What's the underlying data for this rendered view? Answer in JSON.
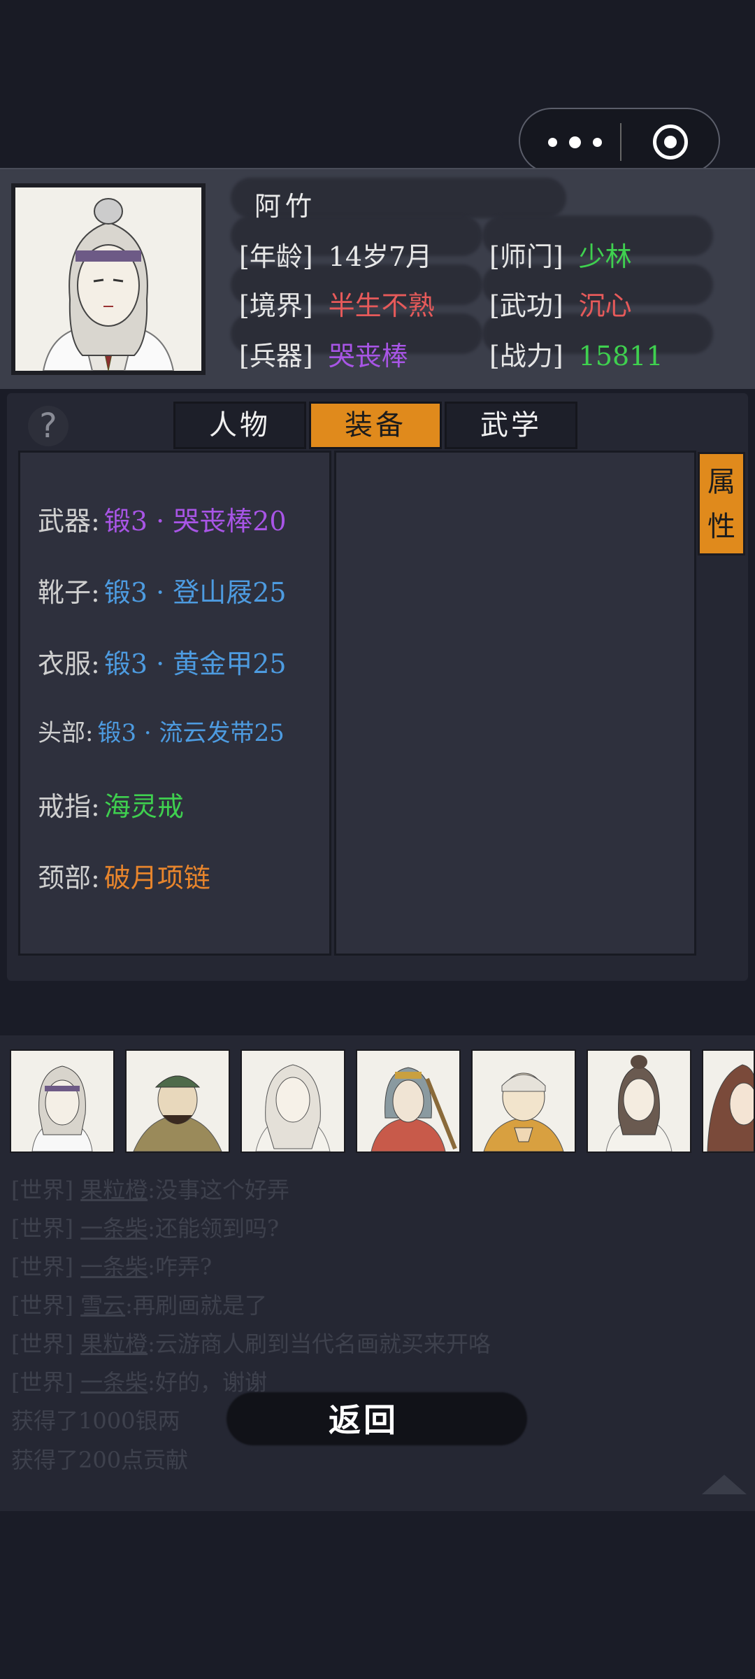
{
  "character": {
    "name": "阿竹",
    "age_label": "[年龄]",
    "age_value": "14岁7月",
    "sect_label": "[师门]",
    "sect_value": "少林",
    "realm_label": "[境界]",
    "realm_value": "半生不熟",
    "martial_label": "[武功]",
    "martial_value": "沉心",
    "weapon_label": "[兵器]",
    "weapon_value": "哭丧棒",
    "power_label": "[战力]",
    "power_value": "15811"
  },
  "tabs": [
    "人物",
    "装备",
    "武学"
  ],
  "active_tab": "装备",
  "side_tab": "属性",
  "help_icon": "?",
  "equipment": [
    {
      "label": "武器:",
      "value": "锻3 · 哭丧棒20",
      "color": "#a855e6"
    },
    {
      "label": "靴子:",
      "value": "锻3 · 登山屐25",
      "color": "#4d9be0"
    },
    {
      "label": "衣服:",
      "value": "锻3 · 黄金甲25",
      "color": "#4d9be0"
    },
    {
      "label": "头部:",
      "value": "锻3 · 流云发带25",
      "color": "#4d9be0"
    },
    {
      "label": "戒指:",
      "value": "海灵戒",
      "color": "#3fd04f"
    },
    {
      "label": "颈部:",
      "value": "破月项链",
      "color": "#e8852c"
    }
  ],
  "colors": {
    "accent": "#e08a1c",
    "green": "#3fd04f",
    "purple": "#a855e6",
    "red": "#e65a5a",
    "blue": "#4d9be0"
  },
  "chat": [
    {
      "channel": "[世界]",
      "user": "果粒橙",
      "text": ":没事这个好弄"
    },
    {
      "channel": "[世界]",
      "user": "一条柴",
      "text": ":还能领到吗?"
    },
    {
      "channel": "[世界]",
      "user": "一条柴",
      "text": ":咋弄?"
    },
    {
      "channel": "[世界]",
      "user": "雪云",
      "text": ":再刷画就是了"
    },
    {
      "channel": "[世界]",
      "user": "果粒橙",
      "text": ":云游商人刷到当代名画就买来开咯"
    },
    {
      "channel": "[世界]",
      "user": "一条柴",
      "text": ":好的，谢谢"
    }
  ],
  "rewards": [
    "获得了1000银两",
    "获得了200点贡献"
  ],
  "back_label": "返回"
}
